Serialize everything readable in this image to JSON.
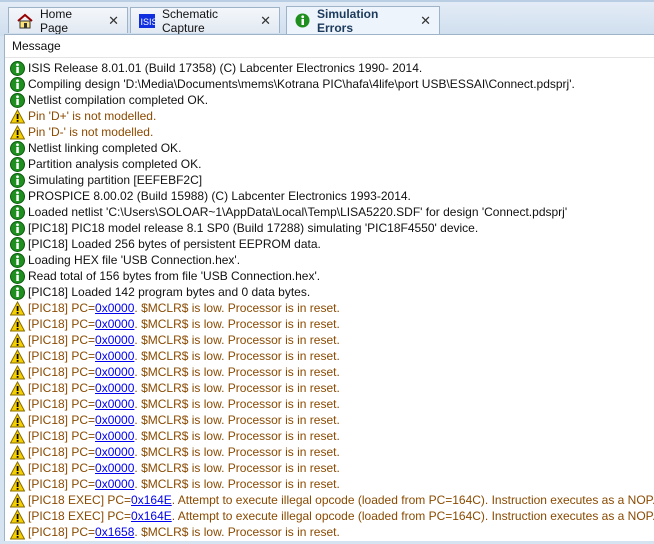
{
  "tabs": [
    {
      "label": "Home Page",
      "icon": "home-icon",
      "active": false
    },
    {
      "label": "Schematic Capture",
      "icon": "isis-icon",
      "active": false
    },
    {
      "label": "Simulation Errors",
      "icon": "info-icon",
      "active": true
    }
  ],
  "close_glyph": "✕",
  "header": {
    "column": "Message"
  },
  "messages": [
    {
      "type": "info",
      "text": "ISIS Release 8.01.01 (Build 17358) (C) Labcenter Electronics 1990- 2014."
    },
    {
      "type": "info",
      "text": "Compiling design 'D:\\Media\\Documents\\mems\\Kotrana PIC\\hafa\\4life\\port USB\\ESSAI\\Connect.pdsprj'."
    },
    {
      "type": "info",
      "text": "Netlist compilation completed OK."
    },
    {
      "type": "warn",
      "text": "Pin 'D+' is not modelled."
    },
    {
      "type": "warn",
      "text": "Pin 'D-' is not modelled."
    },
    {
      "type": "info",
      "text": "Netlist linking completed OK."
    },
    {
      "type": "info",
      "text": "Partition analysis completed OK."
    },
    {
      "type": "info",
      "text": "Simulating partition [EEFEBF2C]"
    },
    {
      "type": "info",
      "text": "PROSPICE 8.00.02 (Build 15988) (C) Labcenter Electronics 1993-2014."
    },
    {
      "type": "info",
      "text": "Loaded netlist 'C:\\Users\\SOLOAR~1\\AppData\\Local\\Temp\\LISA5220.SDF' for design 'Connect.pdsprj'"
    },
    {
      "type": "info",
      "text": "[PIC18] PIC18 model release 8.1 SP0 (Build 17288) simulating 'PIC18F4550' device."
    },
    {
      "type": "info",
      "text": "[PIC18] Loaded 256 bytes of persistent EEPROM data."
    },
    {
      "type": "info",
      "text": "Loading HEX file 'USB Connection.hex'."
    },
    {
      "type": "info",
      "text": "Read total of 156 bytes from file 'USB Connection.hex'."
    },
    {
      "type": "info",
      "text": "[PIC18] Loaded 142 program bytes and 0 data bytes."
    },
    {
      "type": "warn",
      "text": "[PIC18] PC=",
      "link": "0x0000",
      "after": ". $MCLR$ is low. Processor is in reset."
    },
    {
      "type": "warn",
      "text": "[PIC18] PC=",
      "link": "0x0000",
      "after": ". $MCLR$ is low. Processor is in reset."
    },
    {
      "type": "warn",
      "text": "[PIC18] PC=",
      "link": "0x0000",
      "after": ". $MCLR$ is low. Processor is in reset."
    },
    {
      "type": "warn",
      "text": "[PIC18] PC=",
      "link": "0x0000",
      "after": ". $MCLR$ is low. Processor is in reset."
    },
    {
      "type": "warn",
      "text": "[PIC18] PC=",
      "link": "0x0000",
      "after": ". $MCLR$ is low. Processor is in reset."
    },
    {
      "type": "warn",
      "text": "[PIC18] PC=",
      "link": "0x0000",
      "after": ". $MCLR$ is low. Processor is in reset."
    },
    {
      "type": "warn",
      "text": "[PIC18] PC=",
      "link": "0x0000",
      "after": ". $MCLR$ is low. Processor is in reset."
    },
    {
      "type": "warn",
      "text": "[PIC18] PC=",
      "link": "0x0000",
      "after": ". $MCLR$ is low. Processor is in reset."
    },
    {
      "type": "warn",
      "text": "[PIC18] PC=",
      "link": "0x0000",
      "after": ". $MCLR$ is low. Processor is in reset."
    },
    {
      "type": "warn",
      "text": "[PIC18] PC=",
      "link": "0x0000",
      "after": ". $MCLR$ is low. Processor is in reset."
    },
    {
      "type": "warn",
      "text": "[PIC18] PC=",
      "link": "0x0000",
      "after": ". $MCLR$ is low. Processor is in reset."
    },
    {
      "type": "warn",
      "text": "[PIC18] PC=",
      "link": "0x0000",
      "after": ". $MCLR$ is low. Processor is in reset."
    },
    {
      "type": "warn",
      "text": "[PIC18 EXEC] PC=",
      "link": "0x164E",
      "after": ". Attempt to execute illegal opcode (loaded from PC=164C). Instruction executes as a NOP."
    },
    {
      "type": "warn",
      "text": "[PIC18 EXEC] PC=",
      "link": "0x164E",
      "after": ". Attempt to execute illegal opcode (loaded from PC=164C). Instruction executes as a NOP."
    },
    {
      "type": "warn",
      "text": "[PIC18] PC=",
      "link": "0x1658",
      "after": ". $MCLR$ is low. Processor is in reset."
    }
  ],
  "colors": {
    "info_text": "#111111",
    "warn_text": "#8a4a00",
    "link": "#0000ee",
    "info_icon": "#1f8f1f",
    "warn_icon": "#f5d000"
  }
}
